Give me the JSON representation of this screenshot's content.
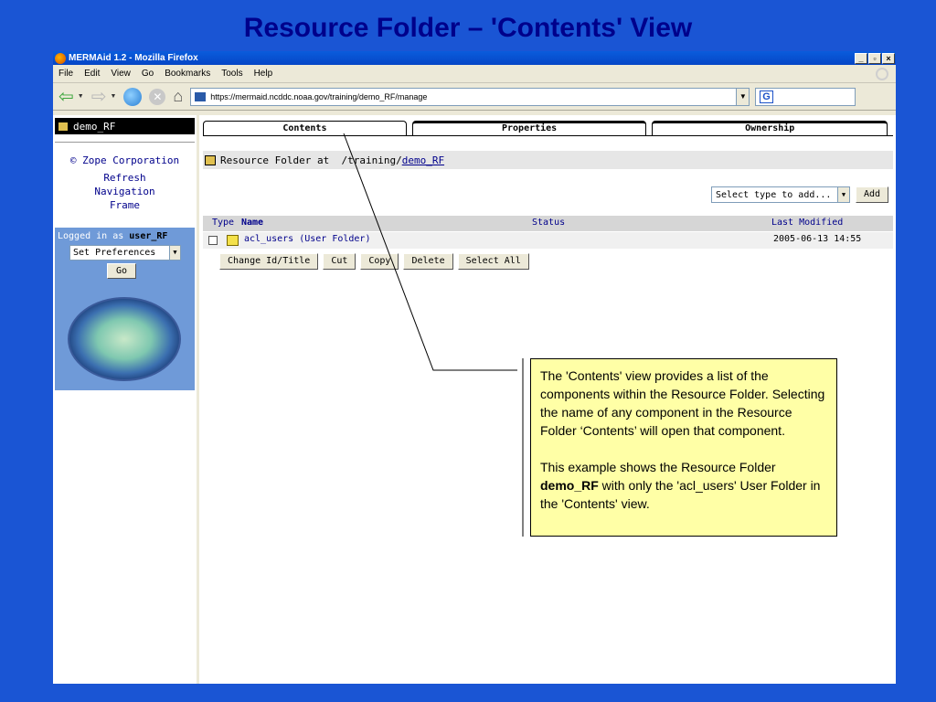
{
  "slide": {
    "title": "Resource Folder – 'Contents' View"
  },
  "window": {
    "title": "MERMAid 1.2 - Mozilla Firefox",
    "controls": {
      "minimize": "_",
      "maximize": "▫",
      "close": "×"
    }
  },
  "menu": {
    "items": [
      "File",
      "Edit",
      "View",
      "Go",
      "Bookmarks",
      "Tools",
      "Help"
    ]
  },
  "address": {
    "url": "https://mermaid.ncddc.noaa.gov/training/demo_RF/manage",
    "search_engine_glyph": "G"
  },
  "left_frame": {
    "folder_name": "demo_RF",
    "links": {
      "copyright": "© Zope Corporation",
      "refresh_1": "Refresh",
      "refresh_2": "Navigation",
      "refresh_3": "Frame"
    },
    "logged_in_label": "Logged in as",
    "username": "user_RF",
    "preferences_select": "Set Preferences",
    "go_button": "Go"
  },
  "main": {
    "tabs": [
      "Contents",
      "Properties",
      "Ownership"
    ],
    "path_label": "Resource Folder at",
    "path_prefix": "/training/",
    "path_link": "demo_RF",
    "type_select": "Select type to add...",
    "add_button": "Add",
    "columns": {
      "type": "Type",
      "name": "Name",
      "status": "Status",
      "modified": "Last Modified"
    },
    "rows": [
      {
        "name": "acl_users (User Folder)",
        "status": "",
        "modified": "2005-06-13 14:55"
      }
    ],
    "actions": [
      "Change Id/Title",
      "Cut",
      "Copy",
      "Delete",
      "Select All"
    ]
  },
  "callout": {
    "para1": "The 'Contents' view provides a list of the components within the Resource Folder. Selecting the name of any component in the Resource Folder ‘Contents’ will open that component.",
    "para2_pre": "This example shows the Resource Folder ",
    "para2_bold": "demo_RF",
    "para2_post": " with only the 'acl_users' User Folder in the 'Contents' view."
  }
}
